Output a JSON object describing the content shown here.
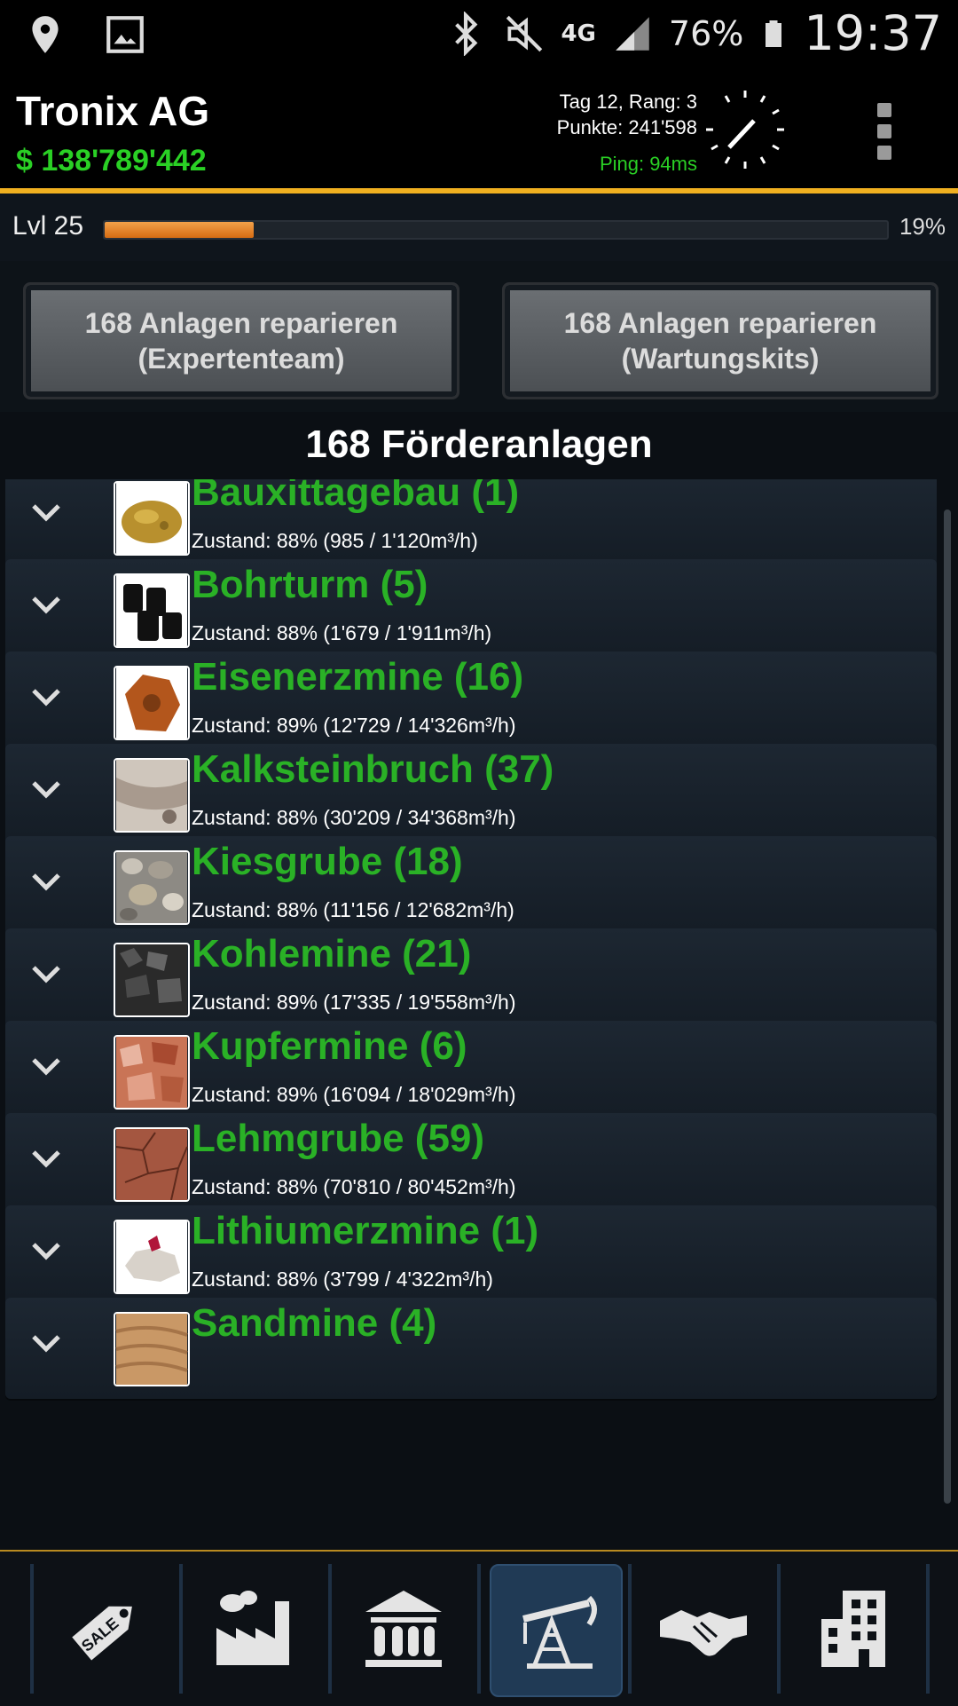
{
  "status_bar": {
    "battery": "76%",
    "time": "19:37",
    "network": "4G",
    "icons": [
      "location-icon",
      "gallery-icon",
      "bluetooth-icon",
      "mute-icon",
      "signal-icon",
      "battery-icon"
    ]
  },
  "header": {
    "company": "Tronix AG",
    "money": "$ 138'789'442",
    "day_rank": "Tag 12, Rang: 3",
    "points": "Punkte: 241'598",
    "ping": "Ping: 94ms"
  },
  "level": {
    "label": "Lvl 25",
    "progress": 0.19,
    "percent": "19%"
  },
  "actions": {
    "repair_expert_line1": "168 Anlagen reparieren",
    "repair_expert_line2": "(Expertenteam)",
    "repair_kits_line1": "168 Anlagen reparieren",
    "repair_kits_line2": "(Wartungskits)"
  },
  "list_title": "168 Förderanlagen",
  "items": [
    {
      "name": "Bauxittagebau (1)",
      "status": "Zustand: 88% (985 / 1'120m³/h)"
    },
    {
      "name": "Bohrturm (5)",
      "status": "Zustand: 88% (1'679 / 1'911m³/h)"
    },
    {
      "name": "Eisenerzmine (16)",
      "status": "Zustand: 89% (12'729 / 14'326m³/h)"
    },
    {
      "name": "Kalksteinbruch (37)",
      "status": "Zustand: 88% (30'209 / 34'368m³/h)"
    },
    {
      "name": "Kiesgrube (18)",
      "status": "Zustand: 88% (11'156 / 12'682m³/h)"
    },
    {
      "name": "Kohlemine (21)",
      "status": "Zustand: 89% (17'335 / 19'558m³/h)"
    },
    {
      "name": "Kupfermine (6)",
      "status": "Zustand: 89% (16'094 / 18'029m³/h)"
    },
    {
      "name": "Lehmgrube (59)",
      "status": "Zustand: 88% (70'810 / 80'452m³/h)"
    },
    {
      "name": "Lithiumerzmine (1)",
      "status": "Zustand: 88% (3'799 / 4'322m³/h)"
    },
    {
      "name": "Sandmine (4)",
      "status": ""
    }
  ],
  "nav": {
    "sale_tag": "SALE",
    "tabs": [
      "sale-tag-icon",
      "factory-icon",
      "bank-icon",
      "oil-pump-icon",
      "handshake-icon",
      "office-building-icon"
    ],
    "active": "oil-pump-icon"
  },
  "colors": {
    "accent_green": "#2ad025",
    "item_green": "#2ab126",
    "header_border": "#f0b020",
    "progress": "#d66b12"
  }
}
